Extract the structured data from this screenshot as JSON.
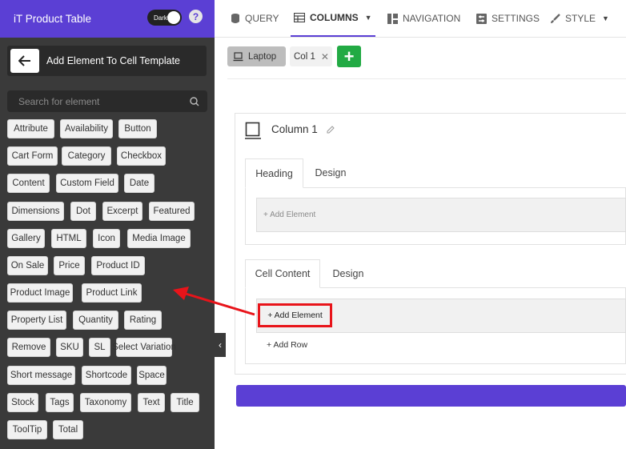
{
  "sidebar": {
    "title": "iT Product Table",
    "toggle_label": "Dark",
    "help_glyph": "?",
    "back_label": "Add Element To Cell Template",
    "search_placeholder": "Search for element",
    "elements": [
      "Attribute",
      "Availability",
      "Button",
      "Cart Form",
      "Category",
      "Checkbox",
      "Content",
      "Custom Field",
      "Date",
      "Dimensions",
      "Dot",
      "Excerpt",
      "Featured",
      "Gallery",
      "HTML",
      "Icon",
      "Media Image",
      "On Sale",
      "Price",
      "Product ID",
      "Product Image",
      "Product Link",
      "Property List",
      "Quantity",
      "Rating",
      "Remove",
      "SKU",
      "SL",
      "Select Variation",
      "Short message",
      "Shortcode",
      "Space",
      "Stock",
      "Tags",
      "Taxonomy",
      "Text",
      "Title",
      "ToolTip",
      "Total"
    ]
  },
  "topnav": {
    "query": "QUERY",
    "columns": "COLUMNS",
    "navigation": "NAVIGATION",
    "settings": "SETTINGS",
    "style": "STYLE"
  },
  "toolbar": {
    "device": "Laptop",
    "column_tab": "Col 1",
    "add_column_glyph": "+"
  },
  "column": {
    "title": "Column  1",
    "heading_tabs": [
      "Heading",
      "Design"
    ],
    "heading_add": "+ Add Element",
    "cell_tabs": [
      "Cell Content",
      "Design"
    ],
    "cell_add": "+ Add Element",
    "add_row": "+ Add Row"
  },
  "colors": {
    "accent": "#5b3fd4",
    "sidebar_bg": "#3a3a3a",
    "add_button": "#22aa44",
    "highlight": "#e8141a"
  }
}
